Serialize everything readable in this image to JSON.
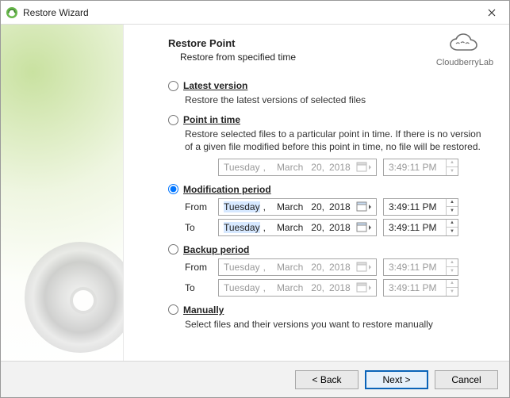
{
  "window": {
    "title": "Restore Wizard"
  },
  "brand": {
    "name": "CloudberryLab"
  },
  "page": {
    "title": "Restore Point",
    "subtitle": "Restore from specified time"
  },
  "options": {
    "selected": "modification_period",
    "latest": {
      "label": "Latest version",
      "desc": "Restore the latest versions of selected files"
    },
    "point_in_time": {
      "label": "Point in time",
      "desc": "Restore selected files to a particular point in time. If there is no version of a given file modified before this point in time, no file will be restored.",
      "date": {
        "weekday": "Tuesday",
        "month": "March",
        "day": "20,",
        "year": "2018"
      },
      "time": "3:49:11 PM"
    },
    "modification_period": {
      "label": "Modification period",
      "from_label": "From",
      "to_label": "To",
      "from": {
        "date": {
          "weekday": "Tuesday",
          "month": "March",
          "day": "20,",
          "year": "2018"
        },
        "time": "3:49:11 PM"
      },
      "to": {
        "date": {
          "weekday": "Tuesday",
          "month": "March",
          "day": "20,",
          "year": "2018"
        },
        "time": "3:49:11 PM"
      }
    },
    "backup_period": {
      "label": "Backup period",
      "from_label": "From",
      "to_label": "To",
      "from": {
        "date": {
          "weekday": "Tuesday",
          "month": "March",
          "day": "20,",
          "year": "2018"
        },
        "time": "3:49:11 PM"
      },
      "to": {
        "date": {
          "weekday": "Tuesday",
          "month": "March",
          "day": "20,",
          "year": "2018"
        },
        "time": "3:49:11 PM"
      }
    },
    "manually": {
      "label": "Manually",
      "desc": "Select files and their versions you want to restore manually"
    }
  },
  "footer": {
    "back": "< Back",
    "next": "Next >",
    "cancel": "Cancel"
  }
}
